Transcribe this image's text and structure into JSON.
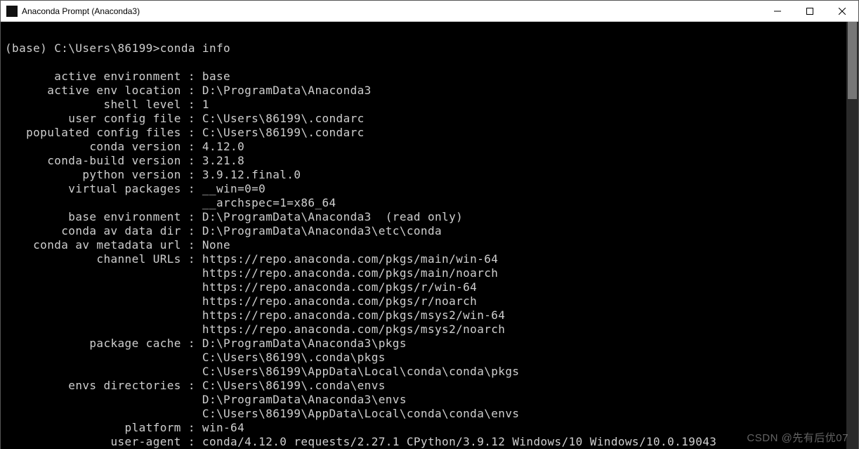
{
  "window": {
    "title": "Anaconda Prompt (Anaconda3)"
  },
  "prompt": {
    "env": "(base) ",
    "path": "C:\\Users\\86199>",
    "command": "conda info"
  },
  "info": {
    "lines": [
      {
        "label": "active environment",
        "value": "base"
      },
      {
        "label": "active env location",
        "value": "D:\\ProgramData\\Anaconda3"
      },
      {
        "label": "shell level",
        "value": "1"
      },
      {
        "label": "user config file",
        "value": "C:\\Users\\86199\\.condarc"
      },
      {
        "label": "populated config files",
        "value": "C:\\Users\\86199\\.condarc"
      },
      {
        "label": "conda version",
        "value": "4.12.0"
      },
      {
        "label": "conda-build version",
        "value": "3.21.8"
      },
      {
        "label": "python version",
        "value": "3.9.12.final.0"
      },
      {
        "label": "virtual packages",
        "value": "__win=0=0"
      },
      {
        "label": "",
        "value": "__archspec=1=x86_64"
      },
      {
        "label": "base environment",
        "value": "D:\\ProgramData\\Anaconda3  (read only)"
      },
      {
        "label": "conda av data dir",
        "value": "D:\\ProgramData\\Anaconda3\\etc\\conda"
      },
      {
        "label": "conda av metadata url",
        "value": "None"
      },
      {
        "label": "channel URLs",
        "value": "https://repo.anaconda.com/pkgs/main/win-64"
      },
      {
        "label": "",
        "value": "https://repo.anaconda.com/pkgs/main/noarch"
      },
      {
        "label": "",
        "value": "https://repo.anaconda.com/pkgs/r/win-64"
      },
      {
        "label": "",
        "value": "https://repo.anaconda.com/pkgs/r/noarch"
      },
      {
        "label": "",
        "value": "https://repo.anaconda.com/pkgs/msys2/win-64"
      },
      {
        "label": "",
        "value": "https://repo.anaconda.com/pkgs/msys2/noarch"
      },
      {
        "label": "package cache",
        "value": "D:\\ProgramData\\Anaconda3\\pkgs"
      },
      {
        "label": "",
        "value": "C:\\Users\\86199\\.conda\\pkgs"
      },
      {
        "label": "",
        "value": "C:\\Users\\86199\\AppData\\Local\\conda\\conda\\pkgs"
      },
      {
        "label": "envs directories",
        "value": "C:\\Users\\86199\\.conda\\envs"
      },
      {
        "label": "",
        "value": "D:\\ProgramData\\Anaconda3\\envs"
      },
      {
        "label": "",
        "value": "C:\\Users\\86199\\AppData\\Local\\conda\\conda\\envs"
      },
      {
        "label": "platform",
        "value": "win-64"
      },
      {
        "label": "user-agent",
        "value": "conda/4.12.0 requests/2.27.1 CPython/3.9.12 Windows/10 Windows/10.0.19043"
      }
    ],
    "label_width": 25
  },
  "watermark": "CSDN @先有后优07"
}
